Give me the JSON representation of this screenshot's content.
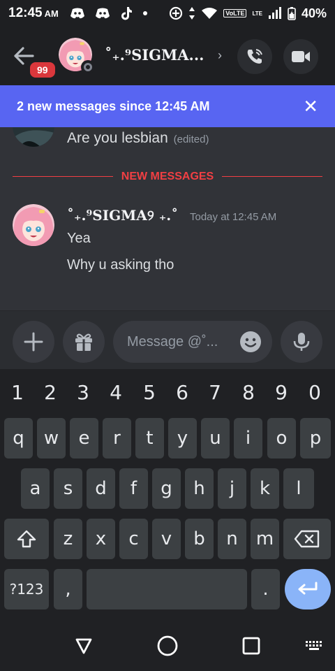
{
  "status_bar": {
    "time": "12:45",
    "ampm": "AM",
    "volte": "VoLTE",
    "lte": "LTE",
    "battery": "40%"
  },
  "header": {
    "unread_badge": "99",
    "channel_name": "˚₊.⁹SIGMA...",
    "chevron": "›"
  },
  "banner": {
    "text": "2 new messages since 12:45 AM",
    "close": "✕"
  },
  "chat": {
    "previous_message": {
      "text": "Are you lesbian",
      "edited": "(edited)"
    },
    "divider_label": "NEW MESSAGES",
    "message": {
      "author": "˚₊.⁹SIGMA୨ ₊.˚",
      "timestamp": "Today at 12:45 AM",
      "lines": [
        "Yea",
        "Why u asking tho"
      ]
    }
  },
  "composer": {
    "placeholder": "Message @˚..."
  },
  "keyboard": {
    "numbers": [
      "1",
      "2",
      "3",
      "4",
      "5",
      "6",
      "7",
      "8",
      "9",
      "0"
    ],
    "row1": [
      "q",
      "w",
      "e",
      "r",
      "t",
      "y",
      "u",
      "i",
      "o",
      "p"
    ],
    "row2": [
      "a",
      "s",
      "d",
      "f",
      "g",
      "h",
      "j",
      "k",
      "l"
    ],
    "row3": [
      "z",
      "x",
      "c",
      "v",
      "b",
      "n",
      "m"
    ],
    "symbols_key": "?123",
    "comma_key": ",",
    "period_key": "."
  },
  "colors": {
    "blurple": "#5865f2",
    "danger": "#da373c",
    "background": "#1e1f22",
    "chat_bg": "#313338"
  }
}
